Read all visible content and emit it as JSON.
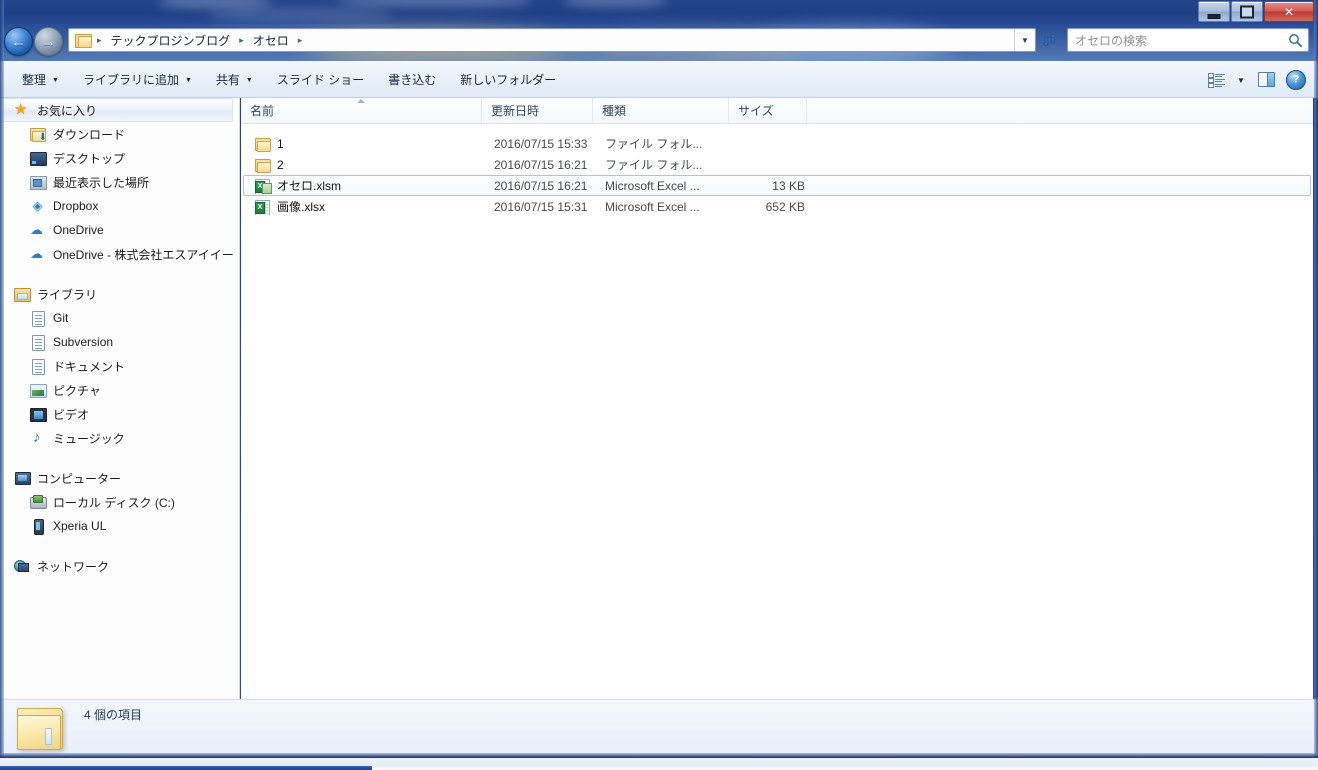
{
  "window": {
    "controls": {
      "minimize": "–",
      "restore": "□",
      "close": "✕"
    }
  },
  "navigation": {
    "back_label": "←",
    "forward_label": "→",
    "recent_caret": "▼",
    "refresh_label": "↺"
  },
  "address": {
    "folder_icon": "folder-icon",
    "separator": "▸",
    "crumbs": [
      {
        "label": "テックプロジンブログ"
      },
      {
        "label": "オセロ"
      }
    ],
    "dropdown_caret": "▼"
  },
  "search": {
    "placeholder": "オセロの検索",
    "value": "",
    "icon": "search-icon"
  },
  "toolbar": {
    "buttons": [
      {
        "label": "整理",
        "caret": "▼"
      },
      {
        "label": "ライブラリに追加",
        "caret": "▼"
      },
      {
        "label": "共有",
        "caret": "▼"
      },
      {
        "label": "スライド ショー",
        "caret": ""
      },
      {
        "label": "書き込む",
        "caret": ""
      },
      {
        "label": "新しいフォルダー",
        "caret": ""
      }
    ],
    "view_caret": "▼",
    "help_glyph": "?"
  },
  "sidebar": {
    "groups": [
      {
        "header": {
          "label": "お気に入り",
          "icon": "star-icon",
          "selected": true
        },
        "items": [
          {
            "label": "ダウンロード",
            "icon": "download-folder-icon"
          },
          {
            "label": "デスクトップ",
            "icon": "desktop-icon"
          },
          {
            "label": "最近表示した場所",
            "icon": "recent-places-icon"
          },
          {
            "label": "Dropbox",
            "icon": "dropbox-icon"
          },
          {
            "label": "OneDrive",
            "icon": "onedrive-icon"
          },
          {
            "label": "OneDrive - 株式会社エスアイイー",
            "icon": "onedrive-icon"
          }
        ]
      },
      {
        "header": {
          "label": "ライブラリ",
          "icon": "library-icon",
          "selected": false
        },
        "items": [
          {
            "label": "Git",
            "icon": "library-folder-icon"
          },
          {
            "label": "Subversion",
            "icon": "library-folder-icon"
          },
          {
            "label": "ドキュメント",
            "icon": "documents-icon"
          },
          {
            "label": "ピクチャ",
            "icon": "pictures-icon"
          },
          {
            "label": "ビデオ",
            "icon": "videos-icon"
          },
          {
            "label": "ミュージック",
            "icon": "music-icon"
          }
        ]
      },
      {
        "header": {
          "label": "コンピューター",
          "icon": "computer-icon",
          "selected": false
        },
        "items": [
          {
            "label": "ローカル ディスク (C:)",
            "icon": "local-disk-icon"
          },
          {
            "label": "Xperia UL",
            "icon": "phone-icon"
          }
        ]
      },
      {
        "header": {
          "label": "ネットワーク",
          "icon": "network-icon",
          "selected": false
        },
        "items": []
      }
    ]
  },
  "file_list": {
    "columns": [
      {
        "label": "名前",
        "sorted": true
      },
      {
        "label": "更新日時",
        "sorted": false
      },
      {
        "label": "種類",
        "sorted": false
      },
      {
        "label": "サイズ",
        "sorted": false
      }
    ],
    "rows": [
      {
        "name": "1",
        "date": "2016/07/15 15:33",
        "type": "ファイル フォル...",
        "size": "",
        "icon": "folder-icon",
        "selected": false
      },
      {
        "name": "2",
        "date": "2016/07/15 16:21",
        "type": "ファイル フォル...",
        "size": "",
        "icon": "folder-icon",
        "selected": false
      },
      {
        "name": "オセロ.xlsm",
        "date": "2016/07/15 16:21",
        "type": "Microsoft Excel ...",
        "size": "13 KB",
        "icon": "excel-macro-icon",
        "selected": true
      },
      {
        "name": "画像.xlsx",
        "date": "2016/07/15 15:31",
        "type": "Microsoft Excel ...",
        "size": "652 KB",
        "icon": "excel-icon",
        "selected": false
      }
    ]
  },
  "status": {
    "text": "4 個の項目",
    "icon": "folder-large-icon"
  },
  "colors": {
    "accent": "#1e3f86",
    "title_blue": "#24448c",
    "excel_green": "#1d7a3e",
    "close_red": "#bb3a33"
  }
}
